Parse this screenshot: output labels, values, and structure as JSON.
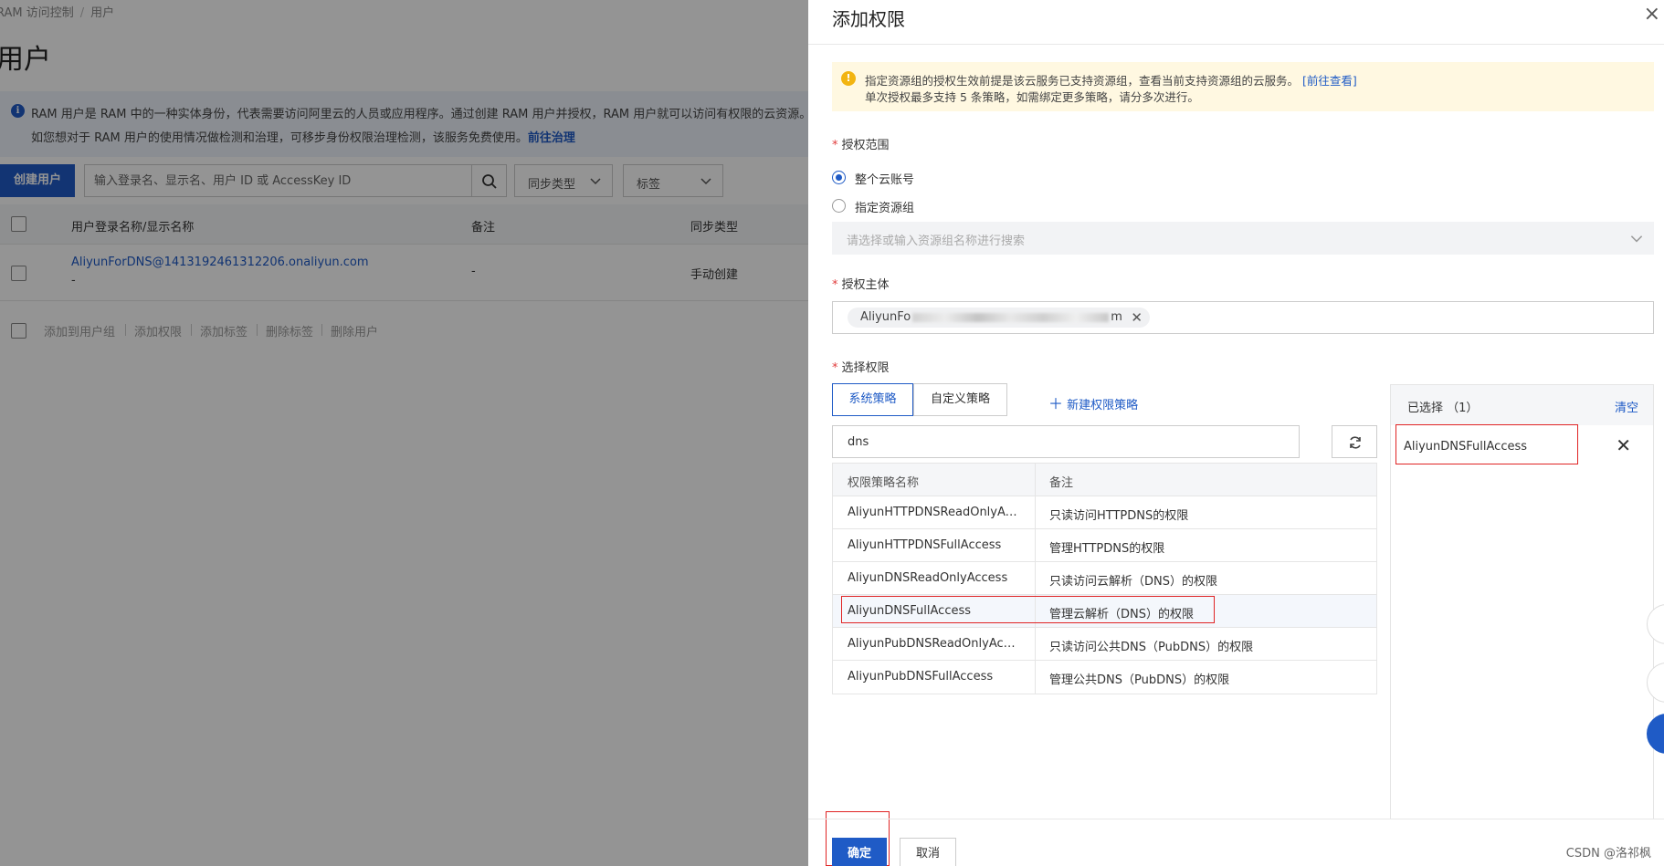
{
  "background": {
    "breadcrumb": [
      "RAM 访问控制",
      "用户"
    ],
    "title": "用户",
    "notice": {
      "line1": "RAM 用户是 RAM 中的一种实体身份，代表需要访问阿里云的人员或应用程序。通过创建 RAM 用户并授权，RAM 用户就可以访问有权限的云资源。",
      "line2": "如您想对于 RAM 用户的使用情况做检测和治理，可移步身份权限治理检测，该服务免费使用。",
      "link": "前往治理"
    },
    "create_button": "创建用户",
    "search_placeholder": "输入登录名、显示名、用户 ID 或 AccessKey ID",
    "filters": {
      "sync_type": "同步类型",
      "tag": "标签"
    },
    "columns": {
      "name": "用户登录名称/显示名称",
      "note": "备注",
      "sync": "同步类型"
    },
    "rows": [
      {
        "login": "AliyunForDNS@1413192461312206.onaliyun.com",
        "display": "-",
        "note": "-",
        "sync": "手动创建"
      }
    ],
    "bulk_actions": [
      "添加到用户组",
      "添加权限",
      "添加标签",
      "删除标签",
      "删除用户"
    ]
  },
  "drawer": {
    "title": "添加权限",
    "close": "×",
    "warning": {
      "line1": "指定资源组的授权生效前提是该云服务已支持资源组，查看当前支持资源组的云服务。",
      "link": "[前往查看]",
      "line2": "单次授权最多支持 5 条策略，如需绑定更多策略，请分多次进行。"
    },
    "scope": {
      "label": "授权范围",
      "options": [
        "整个云账号",
        "指定资源组"
      ],
      "selected": "整个云账号",
      "rg_placeholder": "请选择或输入资源组名称进行搜索"
    },
    "principal": {
      "label": "授权主体",
      "tag_prefix": "AliyunFo",
      "tag_suffix": "m"
    },
    "permissions": {
      "label": "选择权限",
      "tabs": [
        "系统策略",
        "自定义策略"
      ],
      "new_policy": "新建权限策略",
      "search_value": "dns",
      "columns": {
        "name": "权限策略名称",
        "note": "备注"
      },
      "rows": [
        {
          "name": "AliyunHTTPDNSReadOnlyAccess",
          "note": "只读访问HTTPDNS的权限"
        },
        {
          "name": "AliyunHTTPDNSFullAccess",
          "note": "管理HTTPDNS的权限"
        },
        {
          "name": "AliyunDNSReadOnlyAccess",
          "note": "只读访问云解析（DNS）的权限"
        },
        {
          "name": "AliyunDNSFullAccess",
          "note": "管理云解析（DNS）的权限"
        },
        {
          "name": "AliyunPubDNSReadOnlyAccess",
          "note": "只读访问公共DNS（PubDNS）的权限"
        },
        {
          "name": "AliyunPubDNSFullAccess",
          "note": "管理公共DNS（PubDNS）的权限"
        }
      ]
    },
    "selected": {
      "title": "已选择 （1）",
      "clear": "清空",
      "items": [
        "AliyunDNSFullAccess"
      ],
      "remove": "✕"
    },
    "ok_button": "确定",
    "cancel_button": "取消"
  },
  "watermark": "CSDN @洛祁枫",
  "colors": {
    "primary": "#1f5bc6",
    "highlight": "#e02424",
    "warning_bg": "#fff8e1"
  }
}
